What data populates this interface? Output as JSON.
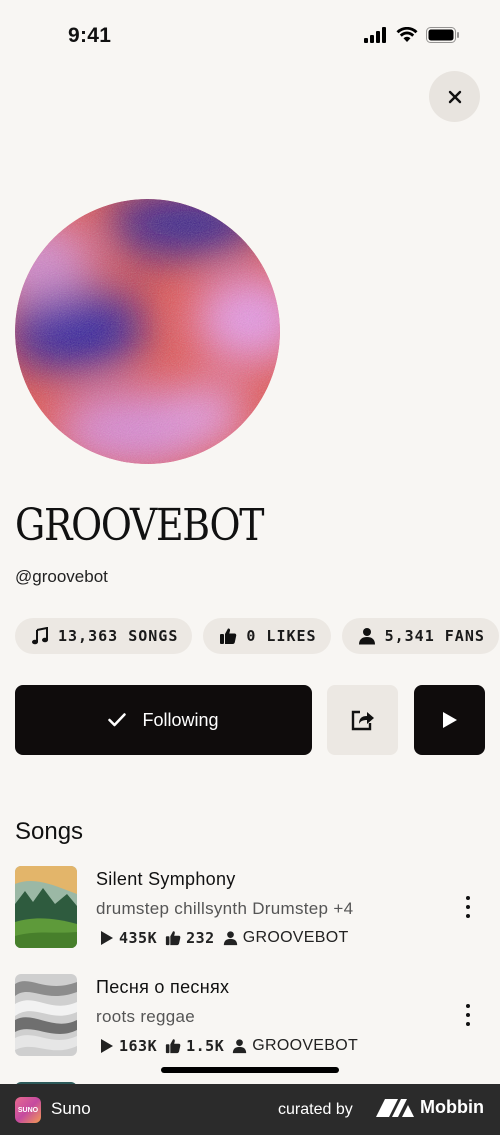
{
  "status_bar": {
    "time": "9:41",
    "icons": [
      "signal-icon",
      "wifi-icon",
      "battery-icon"
    ]
  },
  "header": {
    "close_icon": "close-icon"
  },
  "profile": {
    "name": "GROOVEBOT",
    "handle": "@groovebot",
    "stats": [
      {
        "icon": "music-note-icon",
        "label": "13,363 SONGS"
      },
      {
        "icon": "thumbs-up-icon",
        "label": "0 LIKES"
      },
      {
        "icon": "person-icon",
        "label": "5,341 FANS"
      }
    ]
  },
  "actions": {
    "follow_label": "Following",
    "follow_icon": "checkmark-icon",
    "share_icon": "share-icon",
    "play_icon": "play-icon"
  },
  "songs_section": {
    "title": "Songs",
    "items": [
      {
        "title": "Silent Symphony",
        "tags": "drumstep chillsynth Drumstep +4",
        "plays": "435K",
        "likes": "232",
        "artist": "GROOVEBOT"
      },
      {
        "title": "Песня о песнях",
        "tags": "roots reggae",
        "plays": "163K",
        "likes": "1.5K",
        "artist": "GROOVEBOT"
      }
    ]
  },
  "footer": {
    "app_icon_text": "SUNO",
    "app_name": "Suno",
    "curated_by": "curated by",
    "brand": "Mobbin"
  },
  "colors": {
    "background": "#f8f6f3",
    "chip": "#ece8e3",
    "primary_button": "#0f0c0c",
    "footer": "#2b2b2b"
  }
}
